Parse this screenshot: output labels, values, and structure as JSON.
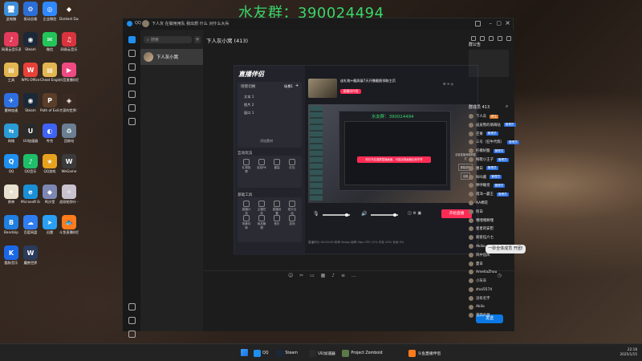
{
  "watermark": "水友群：390024494",
  "desktop_icons": [
    {
      "label": "此电脑",
      "color": "#3d8fd8",
      "glyph": "🖥"
    },
    {
      "label": "驱动总裁",
      "color": "#2b6fd6",
      "glyph": "⚙"
    },
    {
      "label": "企业微信",
      "color": "#2f88ff",
      "glyph": "◎"
    },
    {
      "label": "Darkest Dungeon...",
      "color": "#3b2a20",
      "glyph": "◆"
    },
    {
      "label": "网易云音乐直播",
      "color": "#e33b5a",
      "glyph": "♪"
    },
    {
      "label": "Steam",
      "color": "#1b2838",
      "glyph": "◉"
    },
    {
      "label": "微信",
      "color": "#23c45a",
      "glyph": "✉"
    },
    {
      "label": "网易云音乐",
      "color": "#d9343e",
      "glyph": "♫"
    },
    {
      "label": "工具",
      "color": "#e2b650",
      "glyph": "▤"
    },
    {
      "label": "WPS Office",
      "color": "#e8413a",
      "glyph": "W"
    },
    {
      "label": "Cheat Engine 7.5",
      "color": "#e2b650",
      "glyph": "▤"
    },
    {
      "label": "抖音直播伴侣",
      "color": "#f04a83",
      "glyph": "▶"
    },
    {
      "label": "雷神加速",
      "color": "#2e6fe0",
      "glyph": "✈"
    },
    {
      "label": "Steam",
      "color": "#1b2838",
      "glyph": "◉"
    },
    {
      "label": "Path of Exile 2",
      "color": "#5a3e2a",
      "glyph": "P"
    },
    {
      "label": "大家的世界: The Scr...",
      "color": "#3a2a22",
      "glyph": "◈"
    },
    {
      "label": "网络",
      "color": "#2a9bd6",
      "glyph": "⇆"
    },
    {
      "label": "UU加速器",
      "color": "#2a2a2a",
      "glyph": "U"
    },
    {
      "label": "夸克",
      "color": "#3f63f5",
      "glyph": "◐"
    },
    {
      "label": "回收站",
      "color": "#6a7f92",
      "glyph": "♻"
    },
    {
      "label": "QQ",
      "color": "#1f8ff0",
      "glyph": "Q"
    },
    {
      "label": "QQ音乐",
      "color": "#1fbf6a",
      "glyph": "♪"
    },
    {
      "label": "QQ游戏",
      "color": "#e6a21d",
      "glyph": "★"
    },
    {
      "label": "WeGame",
      "color": "#3b3b3b",
      "glyph": "W"
    },
    {
      "label": "原神",
      "color": "#e9e1cf",
      "glyph": "✦"
    },
    {
      "label": "Microsoft Edge",
      "color": "#1a8fd6",
      "glyph": "e"
    },
    {
      "label": "鸣沙堂",
      "color": "#7c88b3",
      "glyph": "◆"
    },
    {
      "label": "战双帕弥什 - 丛林高校",
      "color": "#c9c3cf",
      "glyph": "✧"
    },
    {
      "label": "Bandizip",
      "color": "#1f7fe2",
      "glyph": "B"
    },
    {
      "label": "百度网盘",
      "color": "#2f7df0",
      "glyph": "☁"
    },
    {
      "label": "迅雷",
      "color": "#2aa0f5",
      "glyph": "➤"
    },
    {
      "label": "斗鱼直播伴侣",
      "color": "#ff7b1c",
      "glyph": "🐟"
    },
    {
      "label": "酷狗音乐",
      "color": "#1b68e6",
      "glyph": "K"
    },
    {
      "label": "魔兽世界",
      "color": "#2a3b5c",
      "glyph": "W"
    }
  ],
  "qq_window": {
    "title": "QQ",
    "search_placeholder": "搜索",
    "chat_item_name": "下人灰小窝",
    "chat_title": "下人灰小窝 (413)",
    "banner_text": "下人灰  在做用用队 我出想 什么 对什么大兵",
    "input_bubble": "一砂全体成员 开团!",
    "send_label": "发送"
  },
  "live_app": {
    "logo": "直播伴侣",
    "menu_labels": [
      "场景1",
      "+"
    ],
    "scene_title": "场景切换",
    "scene_items": [
      "文本 1",
      "图片 2",
      "窗口 1"
    ],
    "add_source": "添加素材",
    "interact_title": "互动玩法",
    "interact_tools": [
      "礼物投票",
      "连线PK",
      "福袋",
      "红包"
    ],
    "basic_title": "基础工具",
    "basic_tools": [
      "直播计划",
      "主播任务",
      "直播设置",
      "观众互动",
      "场景切换",
      "商品管理",
      "音乐",
      "游戏"
    ],
    "preview_headline": "送礼物+截屏展7天开播截图领取主页",
    "preview_sub": "直播间介绍",
    "preview_watermark": "水友群：390024494",
    "preview_notice": "你已开启竖屏直播画面，可能出现画面比例不符",
    "start_button": "开始直播",
    "right_hint": "设置直播间横屏模式",
    "rec_label": "屏幕录制",
    "settings_label": "设置",
    "status_bar": "直播时长 00:00:00  码率 0kbps  帧率 0fps  CPU 12%  内存 45%  丢帧 0%"
  },
  "right_pane": {
    "header": "群公告",
    "member_header": "群成员 413",
    "members": [
      {
        "name": "下人灰",
        "tag": "群主",
        "tag_color": "#e07b2b"
      },
      {
        "name": "皮皮熊的萌萌哒",
        "tag": "管理员",
        "tag_color": "#2b6fe0"
      },
      {
        "name": "芒果",
        "tag": "管理员",
        "tag_color": "#2b6fe0"
      },
      {
        "name": "三号（狂牛代练）",
        "tag": "管理员",
        "tag_color": "#2b6fe0"
      },
      {
        "name": "柠檬好酸",
        "tag": "管理员",
        "tag_color": "#2b6fe0"
      },
      {
        "name": "拖鞋小王子",
        "tag": "管理员",
        "tag_color": "#2b6fe0"
      },
      {
        "name": "墨白",
        "tag": "管理员",
        "tag_color": "#2b6fe0"
      },
      {
        "name": "咔咔酱",
        "tag": "管理员",
        "tag_color": "#2b6fe0"
      },
      {
        "name": "呼呼睡觉",
        "tag": "管理员",
        "tag_color": "#2b6fe0"
      },
      {
        "name": "南洋一霸王",
        "tag": "管理员",
        "tag_color": "#2b6fe0"
      },
      {
        "name": "AA棉花",
        "tag": "",
        "tag_color": ""
      },
      {
        "name": "阿白",
        "tag": "",
        "tag_color": ""
      },
      {
        "name": "嘿嘿嘿啊嘿",
        "tag": "",
        "tag_color": ""
      },
      {
        "name": "星星的安慰",
        "tag": "",
        "tag_color": ""
      },
      {
        "name": "刺客伍六七",
        "tag": "",
        "tag_color": ""
      },
      {
        "name": "Akiko",
        "tag": "",
        "tag_color": ""
      },
      {
        "name": "风中追风",
        "tag": "",
        "tag_color": ""
      },
      {
        "name": "夏日",
        "tag": "",
        "tag_color": ""
      },
      {
        "name": "AmeliaZhou",
        "tag": "",
        "tag_color": ""
      },
      {
        "name": "小灰灰",
        "tag": "",
        "tag_color": ""
      },
      {
        "name": "zhoi5574",
        "tag": "",
        "tag_color": ""
      },
      {
        "name": "没有名字",
        "tag": "",
        "tag_color": ""
      },
      {
        "name": "Akilo",
        "tag": "",
        "tag_color": ""
      },
      {
        "name": "夜雨声烦",
        "tag": "",
        "tag_color": ""
      }
    ]
  },
  "taskbar": {
    "items": [
      {
        "label": "QQ",
        "color": "#1f8ff0"
      },
      {
        "label": "Steam",
        "color": "#1b2838"
      },
      {
        "label": "UU加速器",
        "color": "#2a2a2a"
      },
      {
        "label": "Project Zomboid",
        "color": "#5b7a4a"
      },
      {
        "label": "斗鱼直播伴侣",
        "color": "#ff7b1c"
      }
    ],
    "time": "22:18",
    "date": "2025/1/15"
  }
}
